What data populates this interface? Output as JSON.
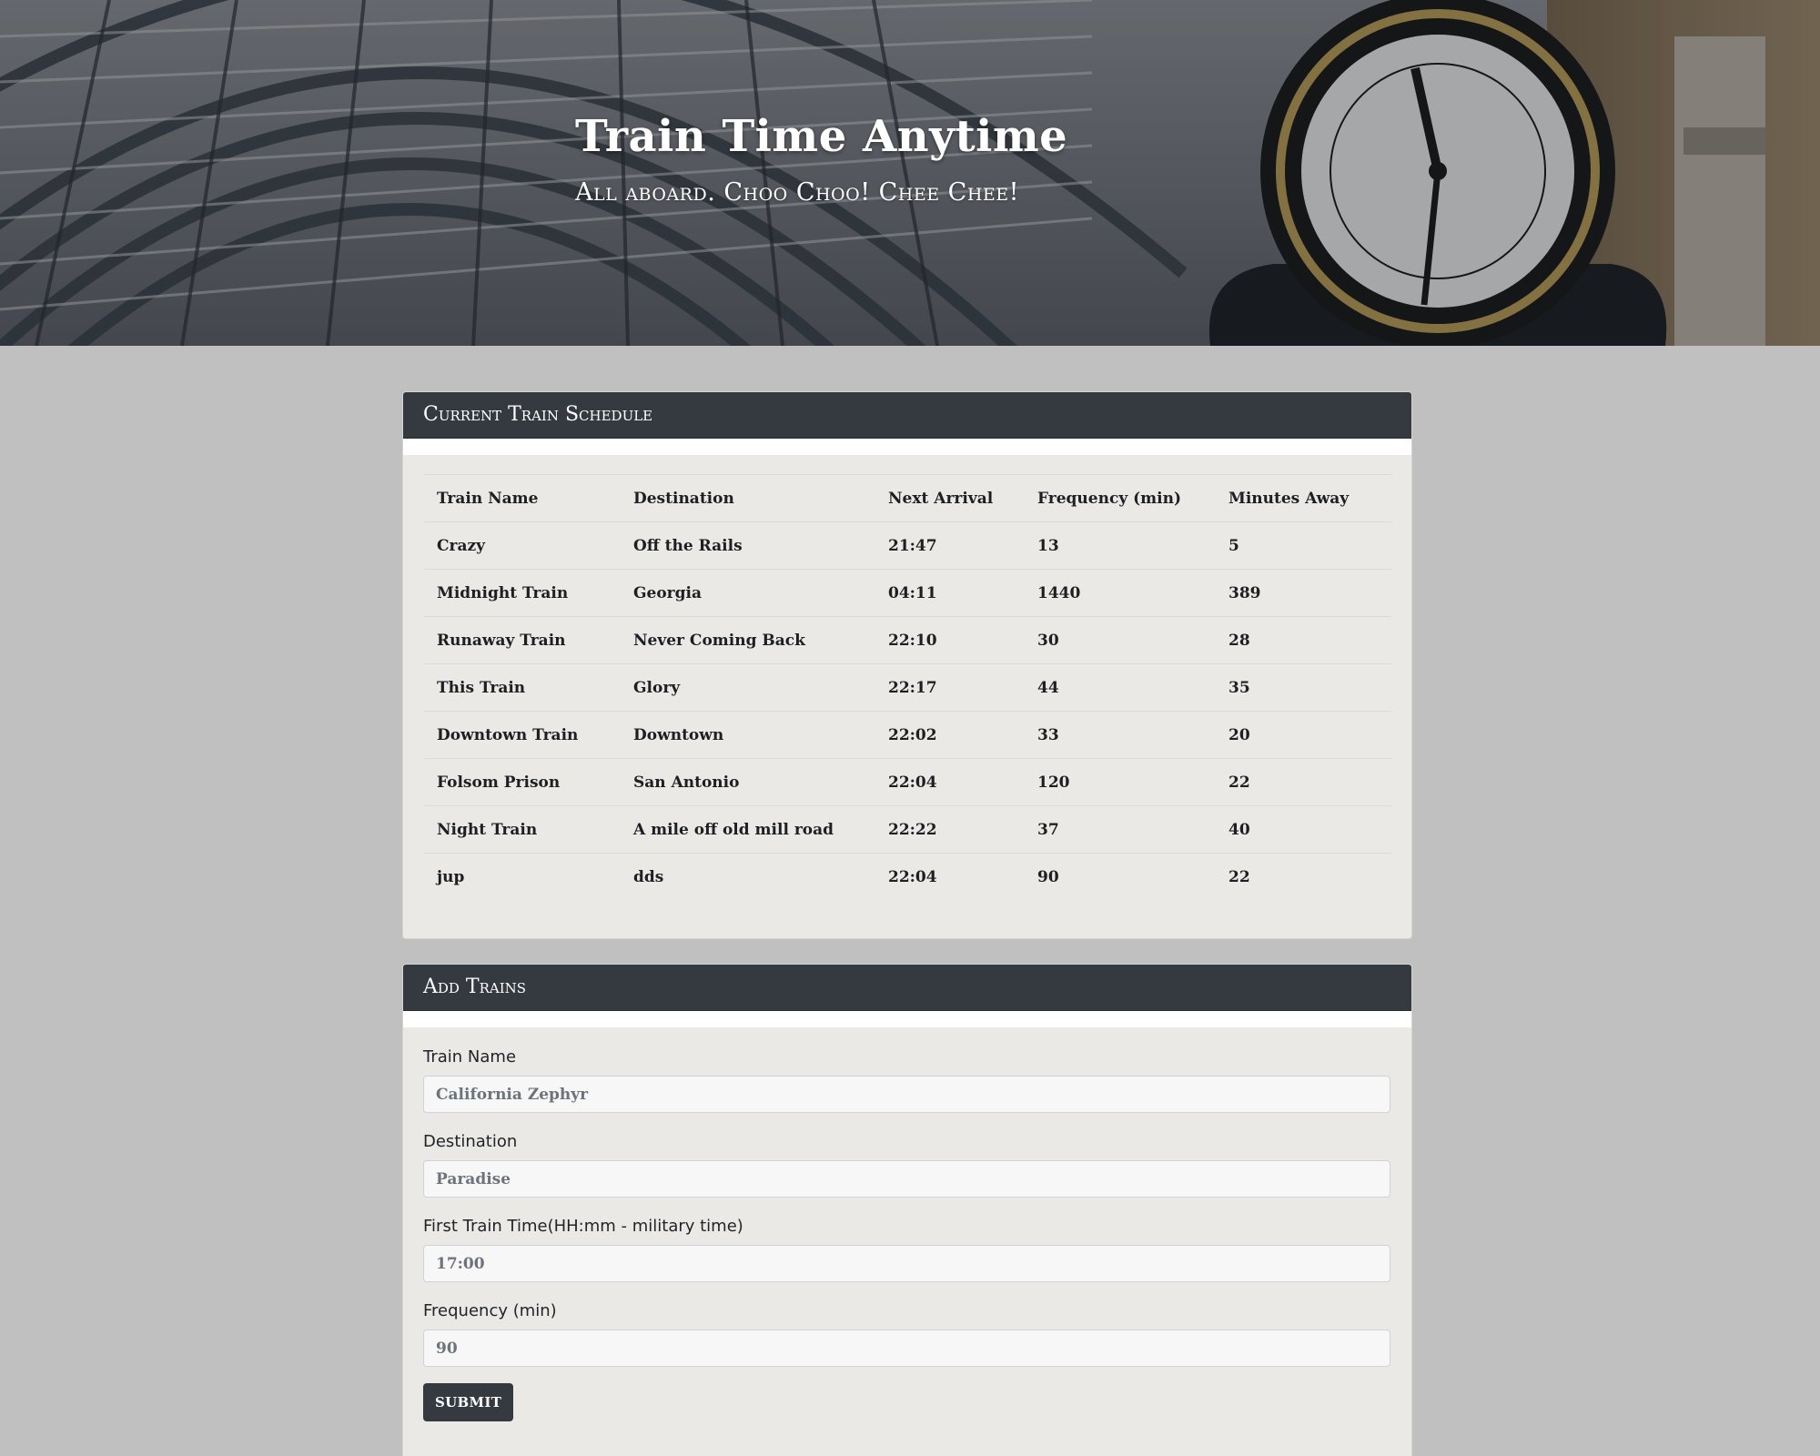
{
  "header": {
    "title": "Train Time Anytime",
    "subtitle": "All aboard. Choo Choo! Chee Chee!"
  },
  "schedule": {
    "heading": "Current Train Schedule",
    "columns": [
      "Train Name",
      "Destination",
      "Next Arrival",
      "Frequency (min)",
      "Minutes Away"
    ],
    "rows": [
      [
        "Crazy",
        "Off the Rails",
        "21:47",
        "13",
        "5"
      ],
      [
        "Midnight Train",
        "Georgia",
        "04:11",
        "1440",
        "389"
      ],
      [
        "Runaway Train",
        "Never Coming Back",
        "22:10",
        "30",
        "28"
      ],
      [
        "This Train",
        "Glory",
        "22:17",
        "44",
        "35"
      ],
      [
        "Downtown Train",
        "Downtown",
        "22:02",
        "33",
        "20"
      ],
      [
        "Folsom Prison",
        "San Antonio",
        "22:04",
        "120",
        "22"
      ],
      [
        "Night Train",
        "A mile off old mill road",
        "22:22",
        "37",
        "40"
      ],
      [
        "jup",
        "dds",
        "22:04",
        "90",
        "22"
      ]
    ]
  },
  "form": {
    "heading": "Add Trains",
    "fields": {
      "train_name": {
        "label": "Train Name",
        "placeholder": "California Zephyr",
        "value": ""
      },
      "destination": {
        "label": "Destination",
        "placeholder": "Paradise",
        "value": ""
      },
      "first_time": {
        "label": "First Train Time(HH:mm - military time)",
        "placeholder": "17:00",
        "value": ""
      },
      "frequency": {
        "label": "Frequency (min)",
        "placeholder": "90",
        "value": ""
      }
    },
    "submit_label": "SUBMIT"
  },
  "colors": {
    "page_background": "#c0c0c0",
    "card_header": "#343a40",
    "card_body": "#ebe9e5",
    "button": "#343a40"
  },
  "icons": [
    "train-station-roof-image",
    "station-clock-image"
  ]
}
